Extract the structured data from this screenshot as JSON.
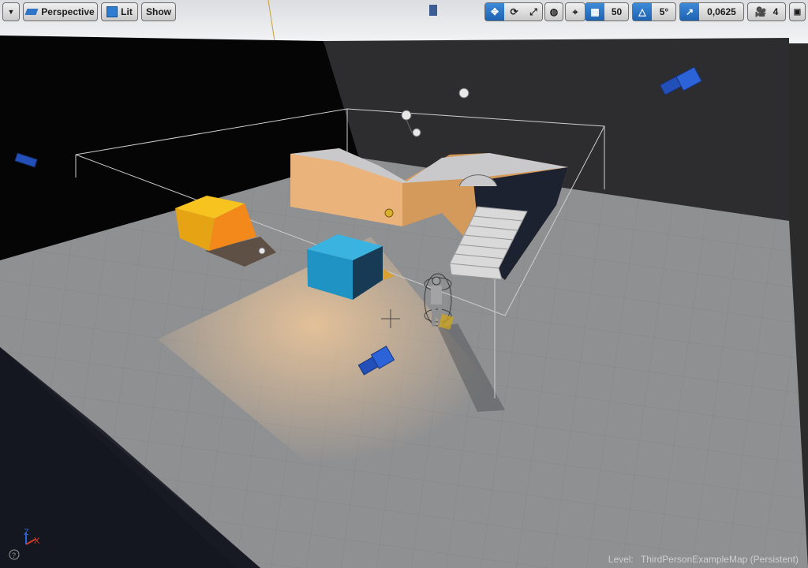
{
  "viewport": {
    "view_mode": "Perspective",
    "lighting_mode": "Lit",
    "show_label": "Show",
    "grid_snap_value": "50",
    "rotation_snap_value": "5°",
    "scale_snap_value": "0,0625",
    "camera_speed_value": "4"
  },
  "icons": {
    "menu": "chevron-down-icon",
    "perspective": "perspective-icon",
    "lit": "lit-icon",
    "translate": "translate-icon",
    "rotate": "rotate-icon",
    "scale": "scale-icon",
    "world": "world-icon",
    "surface": "surface-snapping-icon",
    "grid": "grid-icon",
    "angle": "angle-icon",
    "scale_snap": "scale-snap-icon",
    "camera": "camera-speed-icon",
    "maximize": "maximize-icon"
  },
  "status": {
    "level_label": "Level:",
    "level_name": "ThirdPersonExampleMap (Persistent)"
  },
  "axes": {
    "z": "Z",
    "x": "X"
  },
  "colors": {
    "selection_blue": "#2a6fc4",
    "orange_block": "#f39a16",
    "blue_block": "#1f93c4",
    "floor": "#8f9092"
  }
}
